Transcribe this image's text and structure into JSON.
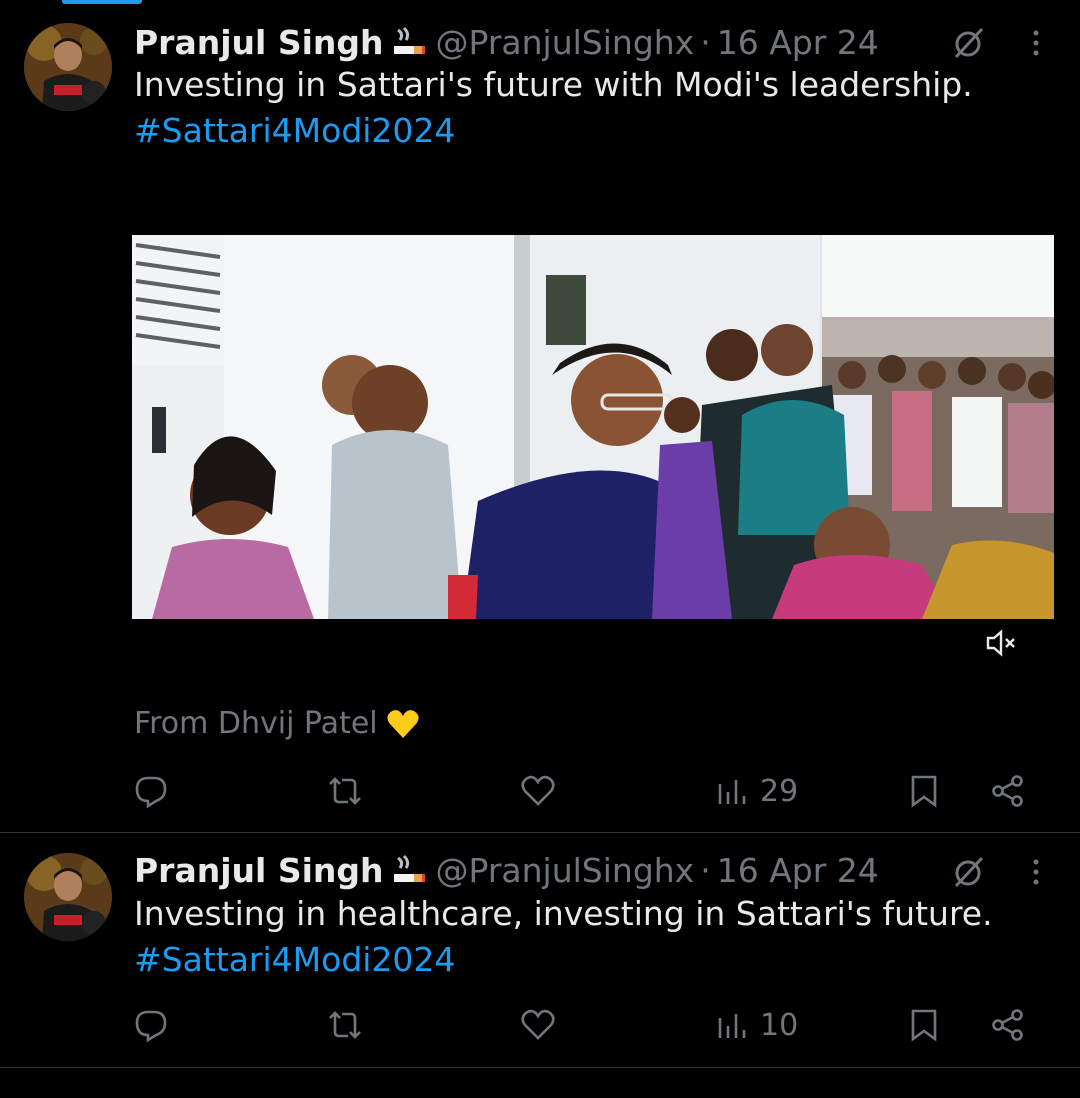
{
  "tweets": [
    {
      "author_name": "Pranjul Singh",
      "handle": "@PranjulSinghx",
      "separator": "·",
      "date": "16 Apr 24",
      "text": "Investing in Sattari's future with Modi's leadership.",
      "hashtag": "#Sattari4Modi2024",
      "attribution": "From Dhvij Patel",
      "views": "29"
    },
    {
      "author_name": "Pranjul Singh",
      "handle": "@PranjulSinghx",
      "separator": "·",
      "date": "16 Apr 24",
      "text": "Investing in healthcare, investing in Sattari's future.",
      "hashtag": "#Sattari4Modi2024",
      "views": "10"
    }
  ],
  "colors": {
    "background": "#000000",
    "text_primary": "#e7e9ea",
    "text_secondary": "#71767b",
    "accent": "#1d9bf0",
    "divider": "#2f3336"
  },
  "icons": {
    "reply": "reply-icon",
    "retweet": "retweet-icon",
    "like": "heart-icon",
    "views": "views-chart-icon",
    "bookmark": "bookmark-icon",
    "share": "share-icon",
    "grok": "grok-slash-icon",
    "more": "more-vertical-icon",
    "mute": "volume-muted-icon",
    "badge": "cigarette-emoji-icon",
    "attribution_emoji": "yellow-heart-emoji-icon"
  }
}
